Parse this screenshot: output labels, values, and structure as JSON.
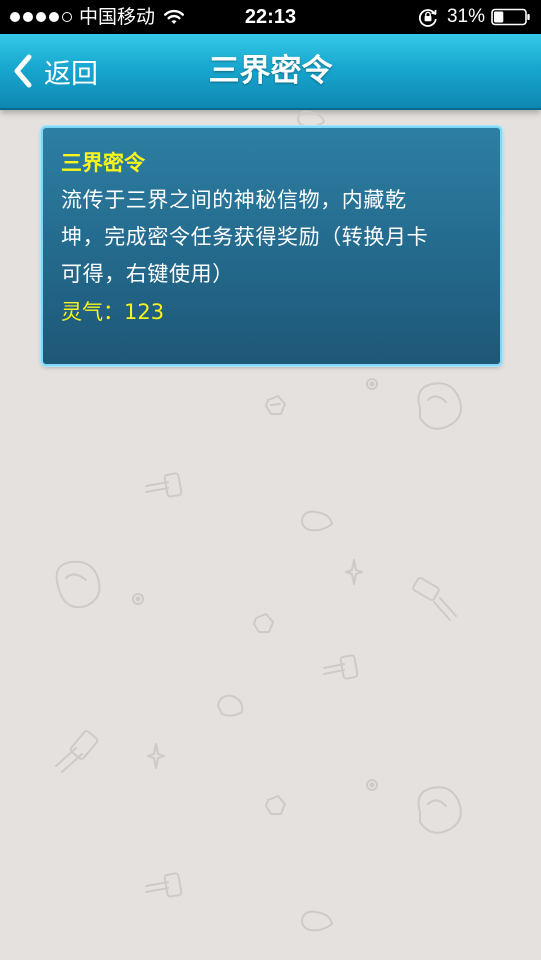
{
  "status_bar": {
    "carrier": "中国移动",
    "time": "22:13",
    "battery_percent": "31%",
    "signal_bars_filled": 4,
    "signal_bars_total": 5,
    "battery_level": 0.31
  },
  "nav": {
    "back_label": "返回",
    "title": "三界密令"
  },
  "item": {
    "name": "三界密令",
    "description_lines": [
      "流传于三界之间的神秘信物，内藏乾",
      "坤，完成密令任务获得奖励（转换月卡",
      "可得，右键使用）"
    ],
    "stat_label": "灵气：",
    "stat_value": "123"
  },
  "colors": {
    "nav_bar_top": "#35c9e8",
    "nav_bar_bottom": "#0e88b3",
    "card_background": "#246b8e",
    "card_border": "#7fd8f6",
    "highlight_text": "#f7f51c",
    "page_background": "#e5e1df"
  },
  "icons": {
    "back": "chevron-left-icon",
    "wifi": "wifi-icon",
    "rotation_lock": "lock-rotation-icon",
    "battery": "battery-icon"
  }
}
